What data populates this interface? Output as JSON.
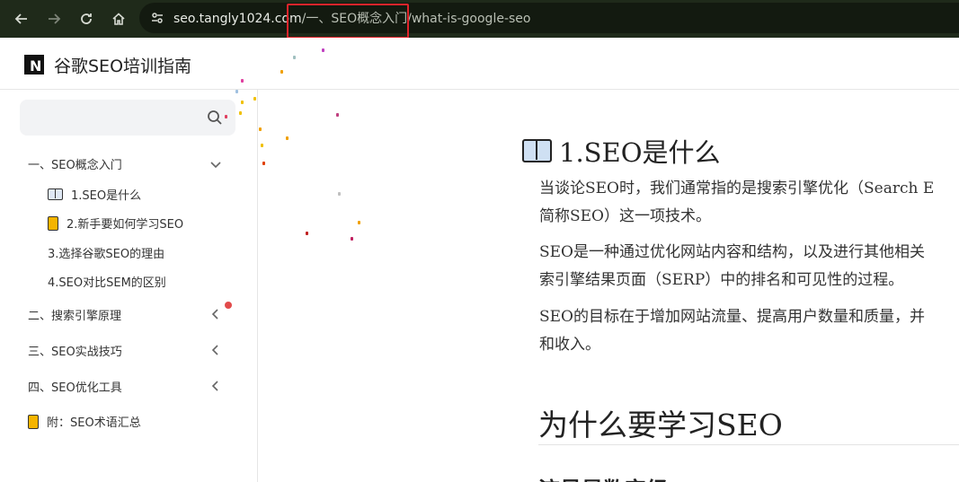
{
  "browser": {
    "url_domain": "seo.tangly1024.com",
    "url_path": "/一、SEO概念入门/what-is-google-seo"
  },
  "site": {
    "title": "谷歌SEO培训指南",
    "logo_letter": "N"
  },
  "sidebar": {
    "search_placeholder": "",
    "sections": [
      {
        "label": "一、SEO概念入门",
        "expanded": true
      },
      {
        "label": "二、搜索引擎原理",
        "expanded": false
      },
      {
        "label": "三、SEO实战技巧",
        "expanded": false
      },
      {
        "label": "四、SEO优化工具",
        "expanded": false
      }
    ],
    "sub_items": [
      {
        "label": "1.SEO是什么",
        "icon": "book-icon"
      },
      {
        "label": "2.新手要如何学习SEO",
        "icon": "notebook-icon"
      },
      {
        "label": "3.选择谷歌SEO的理由",
        "icon": ""
      },
      {
        "label": "4.SEO对比SEM的区别",
        "icon": ""
      }
    ],
    "appendix": {
      "label": "附：SEO术语汇总",
      "icon": "notebook-icon"
    }
  },
  "article": {
    "title": "1.SEO是什么",
    "paragraphs": [
      [
        "当谈论SEO时，我们通常指的是搜索引擎优化（Search E",
        "简称SEO）这一项技术。"
      ],
      [
        "SEO是一种通过优化网站内容和结构，以及进行其他相关",
        "索引擎结果页面（SERP）中的排名和可见性的过程。"
      ],
      [
        "SEO的目标在于增加网站流量、提高用户数量和质量，并",
        "和收入。"
      ]
    ],
    "section_heading": "为什么要学习SEO",
    "sub_heading": "流量是数字经"
  },
  "colors": {
    "browser_bg": "#1f2a1a",
    "highlight_border": "#e0242b",
    "notification_dot": "#e24b4b"
  }
}
